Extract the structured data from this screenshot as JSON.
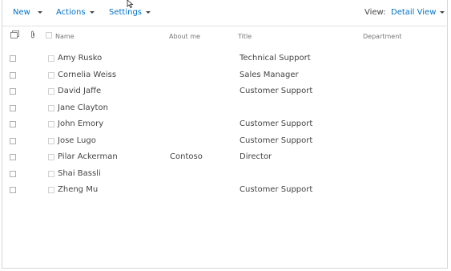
{
  "toolbar": {
    "new_label": "New",
    "actions_label": "Actions",
    "settings_label": "Settings",
    "view_label": "View:",
    "view_value": "Detail View"
  },
  "columns": {
    "name": "Name",
    "about": "About me",
    "title": "Title",
    "department": "Department"
  },
  "rows": [
    {
      "name": "Amy Rusko",
      "about": "",
      "title": "Technical Support"
    },
    {
      "name": "Cornelia Weiss",
      "about": "",
      "title": "Sales Manager"
    },
    {
      "name": "David Jaffe",
      "about": "",
      "title": "Customer Support"
    },
    {
      "name": "Jane Clayton",
      "about": "",
      "title": ""
    },
    {
      "name": "John Emory",
      "about": "",
      "title": "Customer Support"
    },
    {
      "name": "Jose Lugo",
      "about": "",
      "title": "Customer Support"
    },
    {
      "name": "Pilar Ackerman",
      "about": "Contoso",
      "title": "Director"
    },
    {
      "name": "Shai Bassli",
      "about": "",
      "title": ""
    },
    {
      "name": "Zheng Mu",
      "about": "",
      "title": "Customer Support"
    }
  ],
  "icons": {
    "select_all": "multi-select-icon",
    "attachment": "paperclip-icon",
    "cursor": "mouse-pointer-icon"
  }
}
